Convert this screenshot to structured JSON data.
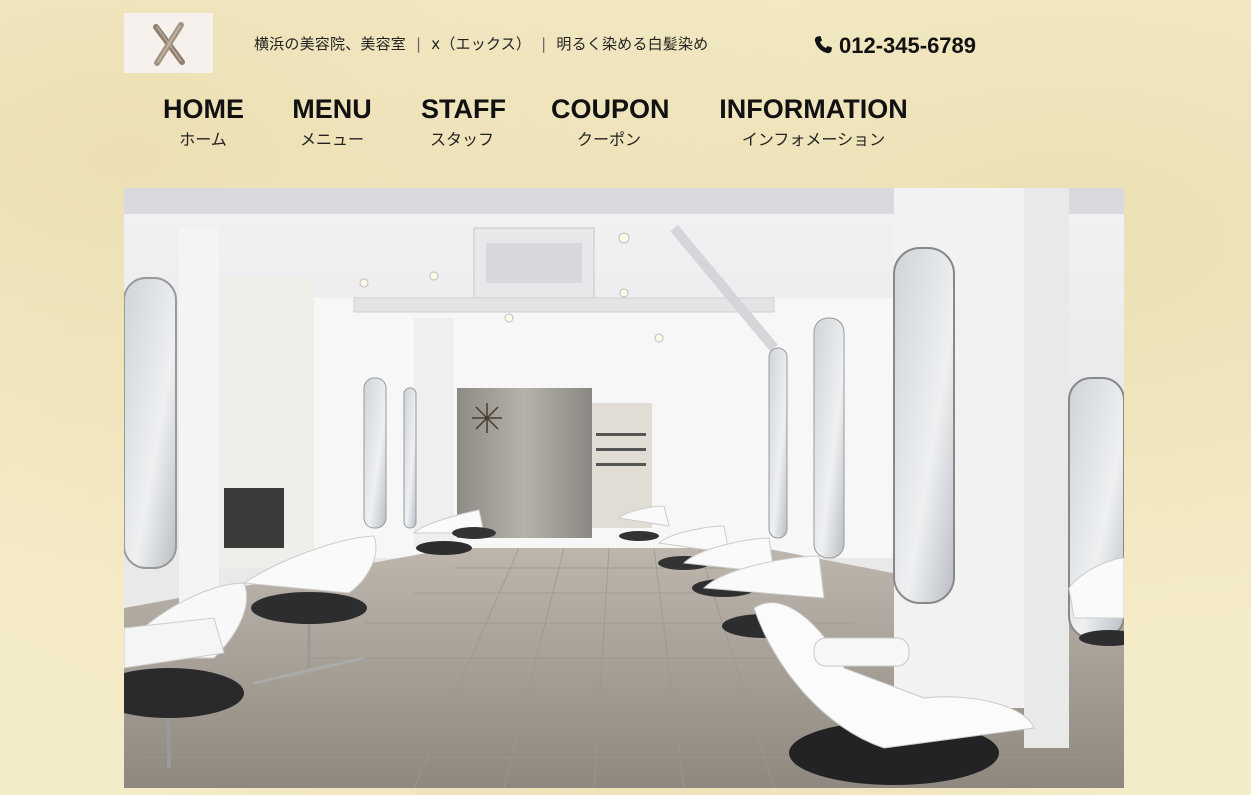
{
  "header": {
    "logo_icon": "x-sticks-logo",
    "tagline": {
      "part1": "横浜の美容院、美容室",
      "separator": "|",
      "part2": "x（エックス）",
      "part3": "明るく染める白髪染め"
    },
    "phone": {
      "icon": "phone-icon",
      "number": "012-345-6789"
    }
  },
  "nav": {
    "items": [
      {
        "en": "HOME",
        "jp": "ホーム"
      },
      {
        "en": "MENU",
        "jp": "メニュー"
      },
      {
        "en": "STAFF",
        "jp": "スタッフ"
      },
      {
        "en": "COUPON",
        "jp": "クーポン"
      },
      {
        "en": "INFORMATION",
        "jp": "インフォメーション"
      }
    ]
  },
  "hero": {
    "image": "salon-interior-photo"
  },
  "colors": {
    "background": "#f4ebc8",
    "text": "#111111",
    "logo_bg": "#f5f0ea",
    "stick": "#9a8878"
  }
}
